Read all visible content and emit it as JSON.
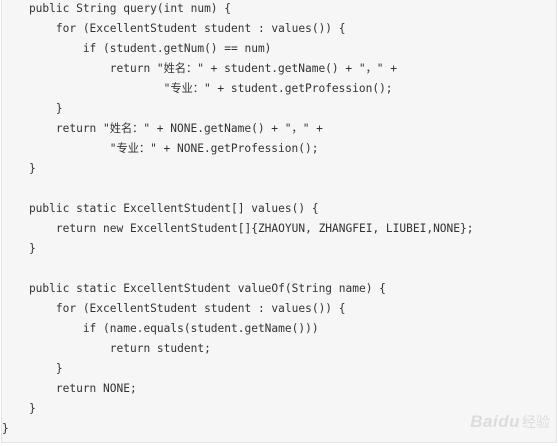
{
  "code": {
    "lines": [
      "    public String query(int num) {",
      "        for (ExcellentStudent student : values()) {",
      "            if (student.getNum() == num)",
      "                return \"姓名：\" + student.getName() + \"，\" +",
      "                        \"专业：\" + student.getProfession();",
      "        }",
      "        return \"姓名：\" + NONE.getName() + \"，\" +",
      "                \"专业：\" + NONE.getProfession();",
      "    }",
      "",
      "    public static ExcellentStudent[] values() {",
      "        return new ExcellentStudent[]{ZHAOYUN, ZHANGFEI, LIUBEI,NONE};",
      "    }",
      "",
      "    public static ExcellentStudent valueOf(String name) {",
      "        for (ExcellentStudent student : values()) {",
      "            if (name.equals(student.getName()))",
      "                return student;",
      "        }",
      "        return NONE;",
      "    }",
      "}"
    ]
  },
  "watermark": {
    "brand": "Baidu",
    "suffix": "经验"
  }
}
